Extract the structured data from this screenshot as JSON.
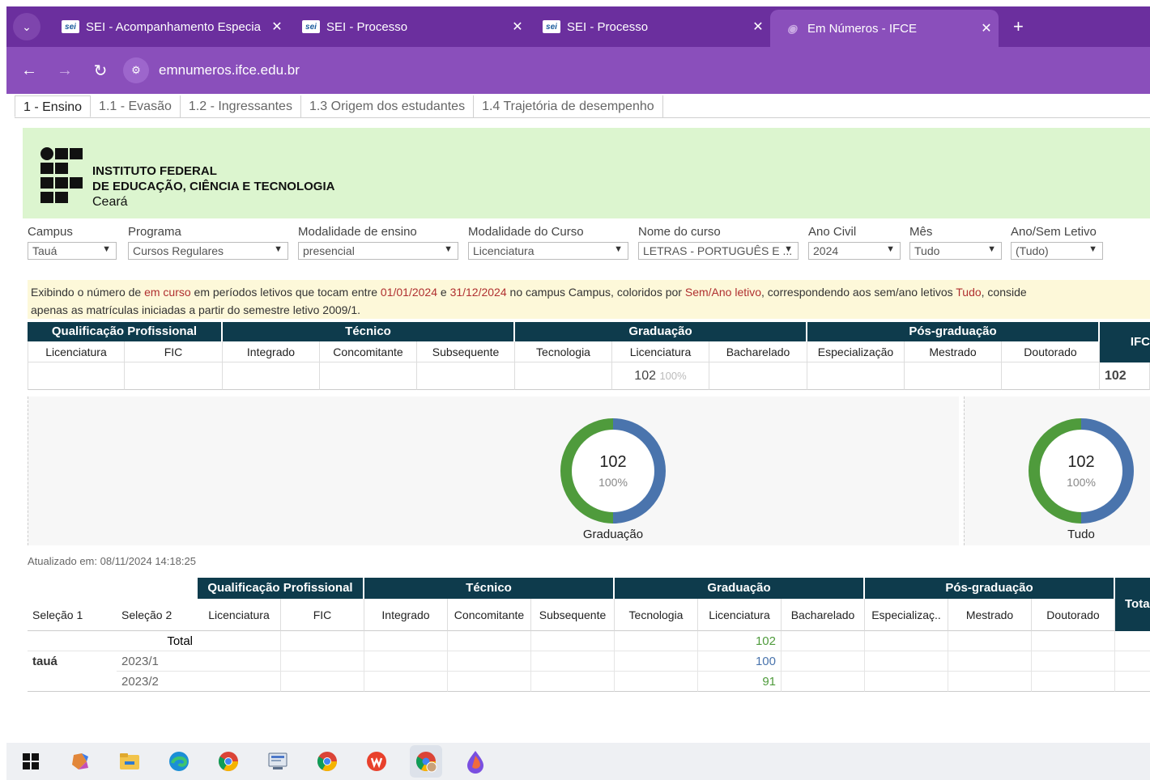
{
  "browser": {
    "tabs": [
      {
        "label": "SEI - Acompanhamento Especia",
        "fav": "sei",
        "active": false
      },
      {
        "label": "SEI - Processo",
        "fav": "sei",
        "active": false
      },
      {
        "label": "SEI - Processo",
        "fav": "sei",
        "active": false
      },
      {
        "label": "Em Números - IFCE",
        "fav": "globe",
        "active": true
      }
    ],
    "new_tab": "+",
    "url": "emnumeros.ifce.edu.br"
  },
  "workbook_tabs": [
    "1 - Ensino",
    "1.1 - Evasão",
    "1.2 - Ingressantes",
    "1.3 Origem dos estudantes",
    "1.4 Trajetória de desempenho"
  ],
  "institution": {
    "line1": "INSTITUTO FEDERAL",
    "line2": "DE EDUCAÇÃO, CIÊNCIA E TECNOLOGIA",
    "line3": "Ceará"
  },
  "filters": [
    {
      "label": "Campus",
      "value": "Tauá"
    },
    {
      "label": "Programa",
      "value": "Cursos Regulares"
    },
    {
      "label": "Modalidade de ensino",
      "value": "presencial"
    },
    {
      "label": "Modalidade do Curso",
      "value": "Licenciatura"
    },
    {
      "label": "Nome do curso",
      "value": "LETRAS - PORTUGUÊS E ..."
    },
    {
      "label": "Ano Civil",
      "value": "2024"
    },
    {
      "label": "Mês",
      "value": "Tudo"
    },
    {
      "label": "Ano/Sem Letivo",
      "value": "(Tudo)"
    }
  ],
  "info": {
    "p1": "Exibindo o número de ",
    "h1": "em curso",
    "p2": " em períodos letivos que tocam entre ",
    "h2": "01/01/2024",
    "p3": " e ",
    "h3": "31/12/2024",
    "p4": " no campus Campus, coloridos por ",
    "h4": "Sem/Ano letivo",
    "p5": ", correspondendo aos sem/ano letivos ",
    "h5": "Tudo",
    "p6": ",  conside",
    "line2": "apenas as matrículas iniciadas a partir do semestre letivo 2009/1."
  },
  "summary": {
    "groups": [
      "Qualificação Profissional",
      "Técnico",
      "Graduação",
      "Pós-graduação",
      "IFC"
    ],
    "subheaders": [
      "Licenciatura",
      "FIC",
      "Integrado",
      "Concomitante",
      "Subsequente",
      "Tecnologia",
      "Licenciatura",
      "Bacharelado",
      "Especialização",
      "Mestrado",
      "Doutorado"
    ],
    "grad_lic_value": "102",
    "grad_lic_pct": "100%",
    "ifc_value": "102"
  },
  "donuts": [
    {
      "value": "102",
      "pct": "100%",
      "label": "Graduação"
    },
    {
      "value": "102",
      "pct": "100%",
      "label": "Tudo"
    }
  ],
  "colors": {
    "green": "#4f9b3c",
    "blue": "#4a74ad",
    "header": "#0e3b4c",
    "banner": "#dcf5cf"
  },
  "updated": "Atualizado em: 08/11/2024 14:18:25",
  "bottom": {
    "row_headers": [
      "Seleção 1",
      "Seleção 2"
    ],
    "groups": [
      "Qualificação Profissional",
      "Técnico",
      "Graduação",
      "Pós-graduação",
      "Tota"
    ],
    "subheaders": [
      "Licenciatura",
      "FIC",
      "Integrado",
      "Concomitante",
      "Subsequente",
      "Tecnologia",
      "Licenciatura",
      "Bacharelado",
      "Especializaç..",
      "Mestrado",
      "Doutorado"
    ],
    "total_label": "Total",
    "total_value": "102",
    "campus": "tauá",
    "rows": [
      {
        "sem": "2023/1",
        "value": "100"
      },
      {
        "sem": "2023/2",
        "value": "91"
      }
    ]
  },
  "taskbar": [
    "windows-icon",
    "copilot-icon",
    "file-explorer-icon",
    "edge-icon",
    "chrome-icon",
    "app-icon",
    "chrome-icon",
    "wps-icon",
    "chrome-profile-icon",
    "drop-icon"
  ]
}
